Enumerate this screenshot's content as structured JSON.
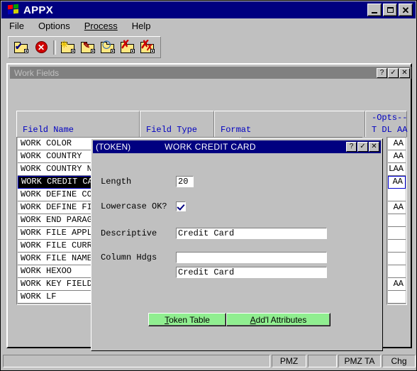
{
  "window": {
    "title": "APPX",
    "logo_icon": "windows-flag-icon",
    "minimize_label": "_",
    "maximize_label": "□",
    "close_label": "✕"
  },
  "menubar": {
    "items": [
      {
        "label": "File",
        "accel": "F"
      },
      {
        "label": "Options",
        "accel": "O"
      },
      {
        "label": "Process",
        "accel": "P"
      },
      {
        "label": "Help",
        "accel": "H"
      }
    ]
  },
  "toolbar": {
    "buttons": [
      {
        "name": "confirm-folder-icon",
        "glyph": "✔",
        "glyph_color": "#000080"
      },
      {
        "name": "cancel-icon",
        "glyph": "✕",
        "glyph_color": "#ffffff"
      },
      {
        "name": "new-folder-icon",
        "glyph": "✳",
        "glyph_color": "#ffd700"
      },
      {
        "name": "edit-folder-icon",
        "glyph": "✎",
        "glyph_color": "#a00000"
      },
      {
        "name": "scan-folder-icon",
        "glyph": "◯",
        "glyph_color": "#4080c0"
      },
      {
        "name": "delete-folder-icon",
        "glyph": "✗",
        "glyph_color": "#cc0000"
      },
      {
        "name": "delete-all-folder-icon",
        "glyph": "✗",
        "glyph_color": "#cc0000"
      }
    ]
  },
  "work_fields_window": {
    "title": "Work Fields",
    "help_label": "?",
    "ok_label": "✓",
    "close_label": "✕"
  },
  "columns": {
    "field_name": "Field Name",
    "field_type": "Field Type",
    "format": "Format",
    "opts_top": "-Opts--",
    "opts_bottom": "T DL AA"
  },
  "field_rows": [
    {
      "name": "WORK COLOR",
      "opts": "AA",
      "lcode": "",
      "selected": false
    },
    {
      "name": "WORK COUNTRY",
      "opts": "AA",
      "lcode": "",
      "selected": false
    },
    {
      "name": "WORK COUNTRY NAM",
      "opts": "AA",
      "lcode": "L",
      "selected": false
    },
    {
      "name": "WORK CREDIT CARD",
      "opts": "AA",
      "lcode": "",
      "selected": true
    },
    {
      "name": "WORK DEFINE COUN",
      "opts": "",
      "lcode": "",
      "selected": false
    },
    {
      "name": "WORK DEFINE FIEL",
      "opts": "AA",
      "lcode": "",
      "selected": false
    },
    {
      "name": "WORK END PARAGRA",
      "opts": "",
      "lcode": "",
      "selected": false
    },
    {
      "name": "WORK FILE APPL I",
      "opts": "",
      "lcode": "",
      "selected": false
    },
    {
      "name": "WORK FILE CURREN",
      "opts": "",
      "lcode": "",
      "selected": false
    },
    {
      "name": "WORK FILE NAME",
      "opts": "",
      "lcode": "",
      "selected": false
    },
    {
      "name": "WORK HEXOO",
      "opts": "",
      "lcode": "",
      "selected": false
    },
    {
      "name": "WORK KEY FIELD N",
      "opts": "AA",
      "lcode": "",
      "selected": false
    },
    {
      "name": "WORK LF",
      "opts": "",
      "lcode": "",
      "selected": false
    }
  ],
  "dialog": {
    "token_label": "(TOKEN)",
    "title": "WORK CREDIT CARD",
    "help_label": "?",
    "ok_label": "✓",
    "close_label": "✕",
    "fields": {
      "length_label": "Length",
      "length_value": "20",
      "lowercase_label": "Lowercase OK?",
      "lowercase_checked": true,
      "descriptive_label": "Descriptive",
      "descriptive_value": "Credit Card",
      "column_hdgs_label": "Column Hdgs",
      "column_hdgs_value_1": "",
      "column_hdgs_value_2": "Credit Card"
    },
    "buttons": {
      "token_table": "Token Table",
      "token_table_accel": "T",
      "addl_attributes": "Add'l Attributes",
      "addl_attributes_accel": "A"
    }
  },
  "statusbar": {
    "message": "",
    "panel_pmz": "PMZ",
    "panel_blank": "",
    "panel_pmz_ta": "PMZ TA",
    "panel_mode": "Chg"
  }
}
